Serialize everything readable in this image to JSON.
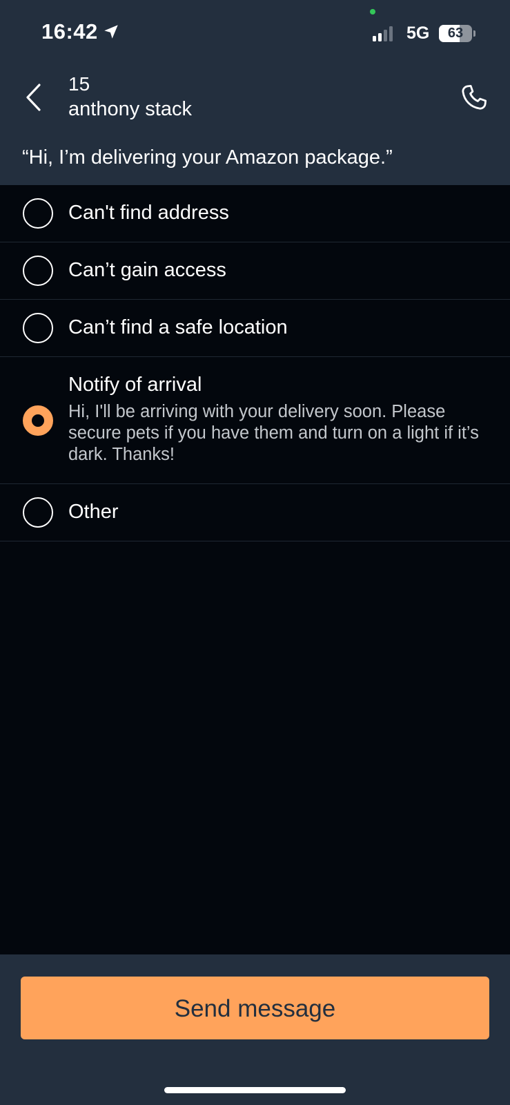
{
  "status_bar": {
    "time": "16:42",
    "network": "5G",
    "battery_level": "63",
    "signal_bars_active": 2,
    "signal_bars_total": 4
  },
  "header": {
    "stop_number": "15",
    "customer_name": "anthony stack",
    "back_icon": "chevron-left-icon",
    "call_icon": "phone-icon"
  },
  "intro_text": "“Hi, I’m delivering your Amazon package.”",
  "options": [
    {
      "label": "Can't find address",
      "selected": false
    },
    {
      "label": "Can’t gain access",
      "selected": false
    },
    {
      "label": "Can’t find a safe location",
      "selected": false
    },
    {
      "label": "Notify of arrival",
      "selected": true,
      "description": "Hi, I'll be arriving with your delivery soon. Please secure pets if you have them and turn on a light if it’s dark. Thanks!"
    },
    {
      "label": "Other",
      "selected": false
    }
  ],
  "footer": {
    "send_label": "Send message"
  },
  "colors": {
    "accent": "#ffa35b",
    "header_bg": "#232f3e",
    "page_bg": "#03070d"
  }
}
